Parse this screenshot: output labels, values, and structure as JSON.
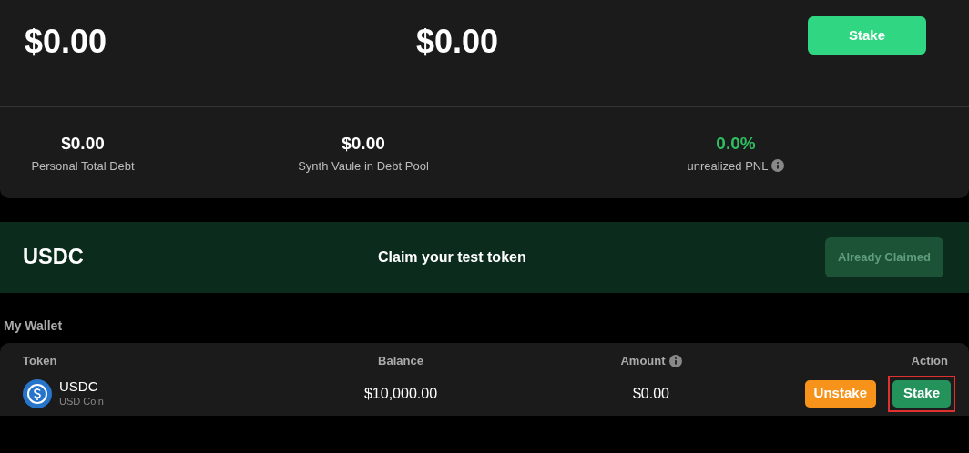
{
  "summary": {
    "values": [
      "$0.00",
      "$0.00"
    ],
    "button": "Stake"
  },
  "stats": [
    {
      "value": "$0.00",
      "label": "Personal Total Debt",
      "kind": "plain",
      "info": false
    },
    {
      "value": "$0.00",
      "label": "Synth Vaule in Debt Pool",
      "kind": "plain",
      "info": false
    },
    {
      "value": "0.0%",
      "label": "unrealized PNL",
      "kind": "gain",
      "info": true
    }
  ],
  "faucet": {
    "token": "USDC",
    "message": "Claim your test token",
    "button": "Already Claimed",
    "disabled": true
  },
  "wallet": {
    "title": "My Wallet",
    "columns": [
      {
        "label": "Token",
        "info": false
      },
      {
        "label": "Balance",
        "info": false
      },
      {
        "label": "Amount",
        "info": true
      },
      {
        "label": "Action",
        "info": false
      }
    ],
    "rows": [
      {
        "symbol": "USDC",
        "name": "USD Coin",
        "balance": "$10,000.00",
        "amount": "$0.00",
        "actions": [
          {
            "kind": "unstake",
            "label": "Unstake",
            "highlighted": false
          },
          {
            "kind": "stake",
            "label": "Stake",
            "highlighted": true
          }
        ]
      }
    ]
  }
}
